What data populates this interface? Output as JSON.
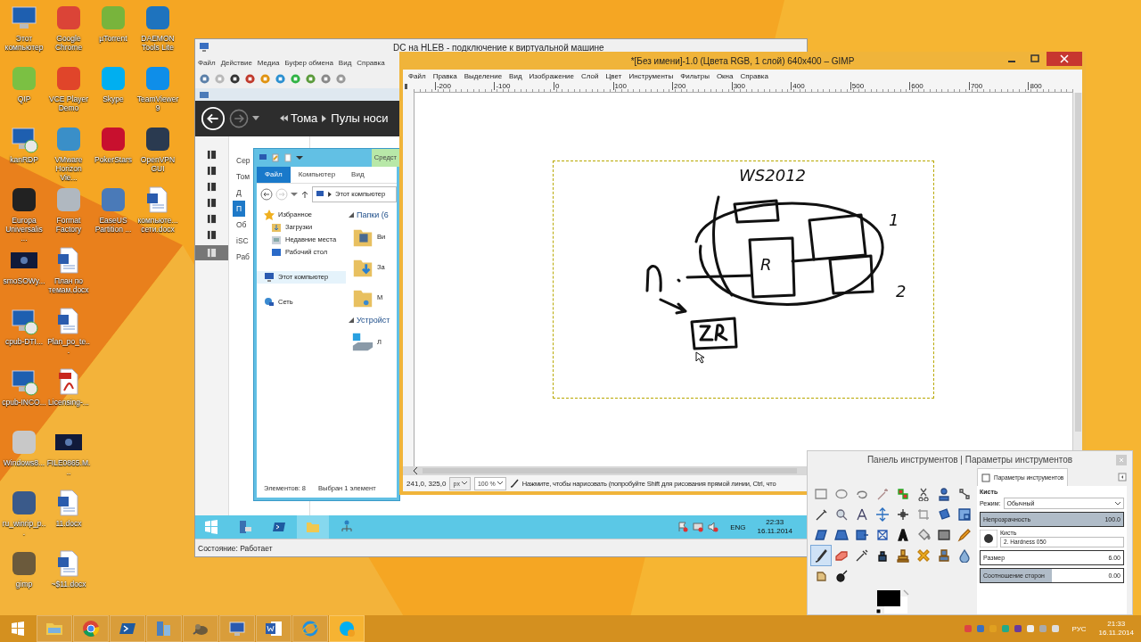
{
  "desktop_columns": [
    {
      "icons": [
        {
          "label": "Этот компьютер",
          "kind": "computer"
        },
        {
          "label": "QIP",
          "kind": "app",
          "color": "#7bc043"
        },
        {
          "label": "kanRDP",
          "kind": "remote"
        },
        {
          "label": "Europa Universalis ...",
          "kind": "app",
          "color": "#222222"
        },
        {
          "label": "smoSOWy...",
          "kind": "media"
        },
        {
          "label": "cpub-DTI...",
          "kind": "remote"
        },
        {
          "label": "cpub-INCO...",
          "kind": "remote"
        },
        {
          "label": "Windows8...",
          "kind": "app",
          "color": "#c8c8c8"
        },
        {
          "label": "ru_winrip_p...",
          "kind": "app",
          "color": "#3a5a8a"
        },
        {
          "label": "gimp",
          "kind": "app",
          "color": "#6b5a3c"
        }
      ]
    },
    {
      "icons": [
        {
          "label": "Google Chrome",
          "kind": "app",
          "color": "#db4437"
        },
        {
          "label": "VCE Player Demo",
          "kind": "app",
          "color": "#e0452a"
        },
        {
          "label": "VMware Horizon Vie...",
          "kind": "app",
          "color": "#3a8fc8"
        },
        {
          "label": "Format Factory",
          "kind": "app",
          "color": "#b0b8c0"
        },
        {
          "label": "План по темам.docx",
          "kind": "document"
        },
        {
          "label": "Plan_po_te...",
          "kind": "document"
        },
        {
          "label": "Licensing-...",
          "kind": "pdf"
        },
        {
          "label": "FILE0865.M...",
          "kind": "media"
        },
        {
          "label": "11.docx",
          "kind": "document"
        },
        {
          "label": "~$11.docx",
          "kind": "document"
        }
      ]
    },
    {
      "icons": [
        {
          "label": "µTorrent",
          "kind": "app",
          "color": "#78b43c"
        },
        {
          "label": "Skype",
          "kind": "app",
          "color": "#00aff0"
        },
        {
          "label": "PokerStars",
          "kind": "app",
          "color": "#c8102e"
        },
        {
          "label": "EaseUS Partition ...",
          "kind": "app",
          "color": "#4a7ab8"
        }
      ]
    },
    {
      "icons": [
        {
          "label": "DAEMON Tools Lite",
          "kind": "app",
          "color": "#1e73be"
        },
        {
          "label": "TeamViewer 9",
          "kind": "app",
          "color": "#0e8ee9"
        },
        {
          "label": "OpenVPN GUI",
          "kind": "app",
          "color": "#2a3a50"
        },
        {
          "label": "компьюте... сети.docx",
          "kind": "document"
        }
      ]
    }
  ],
  "vm_window": {
    "title": "DC на HLEB - подключение к виртуальной машине",
    "menu": [
      "Файл",
      "Действие",
      "Медиа",
      "Буфер обмена",
      "Вид",
      "Справка"
    ],
    "server_manager": {
      "breadcrumb": [
        "Тома",
        "Пулы носи"
      ],
      "sidebar_icons": [
        {
          "selected": false
        },
        {
          "selected": false
        },
        {
          "selected": false
        },
        {
          "selected": false
        },
        {
          "selected": false
        },
        {
          "selected": false
        },
        {
          "selected": true
        }
      ],
      "nav": [
        {
          "label": "Сер",
          "selected": false
        },
        {
          "label": "Том",
          "selected": false
        },
        {
          "label": "Д",
          "selected": false
        },
        {
          "label": "П",
          "selected": true
        },
        {
          "label": "Об",
          "selected": false
        },
        {
          "label": "iSC",
          "selected": false
        },
        {
          "label": "Раб",
          "selected": false
        }
      ]
    },
    "explorer": {
      "context_tab": "Средст",
      "tabs": [
        {
          "label": "Файл",
          "selected": true
        },
        {
          "label": "Компьютер",
          "selected": false
        },
        {
          "label": "Вид",
          "selected": false
        }
      ],
      "address": "Этот компьютер",
      "nav": [
        {
          "label": "Избранное",
          "kind": "favorites",
          "selected": false,
          "children": [
            {
              "label": "Загрузки",
              "kind": "downloads",
              "selected": false
            },
            {
              "label": "Недавние места",
              "kind": "recent",
              "selected": false
            },
            {
              "label": "Рабочий стол",
              "kind": "desktop",
              "selected": false
            }
          ]
        },
        {
          "label": "Этот компьютер",
          "kind": "computer",
          "selected": true
        },
        {
          "label": "Сеть",
          "kind": "network",
          "selected": false
        }
      ],
      "groups": [
        {
          "title": "Папки (6",
          "items": [
            {
              "label": "Ви",
              "kind": "video"
            },
            {
              "label": "За",
              "kind": "download"
            },
            {
              "label": "М",
              "kind": "music"
            }
          ]
        },
        {
          "title": "Устройст",
          "items": [
            {
              "label": "Л",
              "kind": "drive"
            }
          ]
        }
      ],
      "status": [
        "Элементов: 8",
        "Выбран 1 элемент"
      ]
    },
    "taskbar": {
      "apps": [
        {
          "kind": "server",
          "active": false
        },
        {
          "kind": "terminal",
          "active": false
        },
        {
          "kind": "folder",
          "active": true
        },
        {
          "kind": "network",
          "active": false
        }
      ],
      "language": "ENG",
      "time": "22:33",
      "date": "16.11.2014"
    },
    "status": "Состояние: Работает"
  },
  "gimp": {
    "title": "*[Без имени]-1.0 (Цвета RGB, 1 слой) 640x400 – GIMP",
    "menu": [
      "Файл",
      "Правка",
      "Выделение",
      "Вид",
      "Изображение",
      "Слой",
      "Цвет",
      "Инструменты",
      "Фильтры",
      "Окна",
      "Справка"
    ],
    "ruler_ticks": [
      "-200",
      "-100",
      "0",
      "100",
      "200",
      "300",
      "400",
      "500",
      "600",
      "700",
      "800"
    ],
    "sketch_labels": [
      "WS2012",
      "1",
      "2",
      "R"
    ],
    "status": {
      "coords": "241,0, 325,0",
      "unit": "px",
      "zoom": "100 %",
      "hint": "Нажмите, чтобы нарисовать (попробуйте Shift для рисования прямой линии, Ctrl, что"
    }
  },
  "toolbox": {
    "title": "Панель инструментов | Параметры инструментов",
    "tools": [
      {
        "selected": false
      },
      {
        "selected": false
      },
      {
        "selected": false
      },
      {
        "selected": false
      },
      {
        "selected": false
      },
      {
        "selected": false
      },
      {
        "selected": false
      },
      {
        "selected": false
      },
      {
        "selected": false
      },
      {
        "selected": false
      },
      {
        "selected": false
      },
      {
        "selected": false
      },
      {
        "selected": false
      },
      {
        "selected": false
      },
      {
        "selected": false
      },
      {
        "selected": false
      },
      {
        "selected": false
      },
      {
        "selected": false
      },
      {
        "selected": false
      },
      {
        "selected": false
      },
      {
        "selected": false
      },
      {
        "selected": false
      },
      {
        "selected": false
      },
      {
        "selected": false
      },
      {
        "selected": true
      },
      {
        "selected": false
      },
      {
        "selected": false
      },
      {
        "selected": false
      },
      {
        "selected": false
      },
      {
        "selected": false
      },
      {
        "selected": false
      },
      {
        "selected": false
      },
      {
        "selected": false
      },
      {
        "selected": false
      }
    ],
    "options": {
      "tab": "Параметры инструментов",
      "tool_name": "Кисть",
      "mode_label": "Режим:",
      "mode": "Обычный",
      "opacity": {
        "label": "Непрозрачность",
        "value": "100.0",
        "level": 1
      },
      "brush_label": "Кисть",
      "brush": "2. Hardness 050",
      "size": {
        "label": "Размер",
        "value": "6.00",
        "level": 0
      },
      "aspect": {
        "label": "Соотношение сторон",
        "value": "0.00",
        "level": 0.5
      }
    }
  },
  "taskbar": {
    "apps": [
      {
        "kind": "folder",
        "highlighted": false
      },
      {
        "kind": "browser",
        "highlighted": false
      },
      {
        "kind": "terminal",
        "highlighted": false
      },
      {
        "kind": "server",
        "highlighted": false
      },
      {
        "kind": "mascot",
        "highlighted": false
      },
      {
        "kind": "monitor",
        "highlighted": false
      },
      {
        "kind": "word",
        "highlighted": false
      },
      {
        "kind": "globe",
        "highlighted": false
      },
      {
        "kind": "chat",
        "highlighted": true
      }
    ],
    "language": "РУС",
    "time": "21:33",
    "date": "16.11.2014"
  }
}
